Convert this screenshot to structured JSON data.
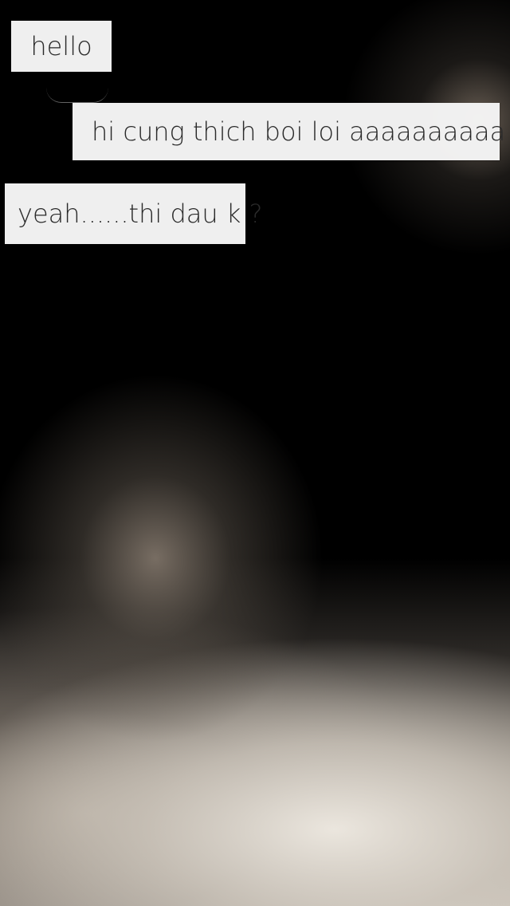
{
  "chat": {
    "messages": [
      {
        "text": "hello"
      },
      {
        "text": "hi cung thich boi loi aaaaaaaaaa"
      },
      {
        "text": "yeah......thi dau k ?"
      }
    ]
  }
}
